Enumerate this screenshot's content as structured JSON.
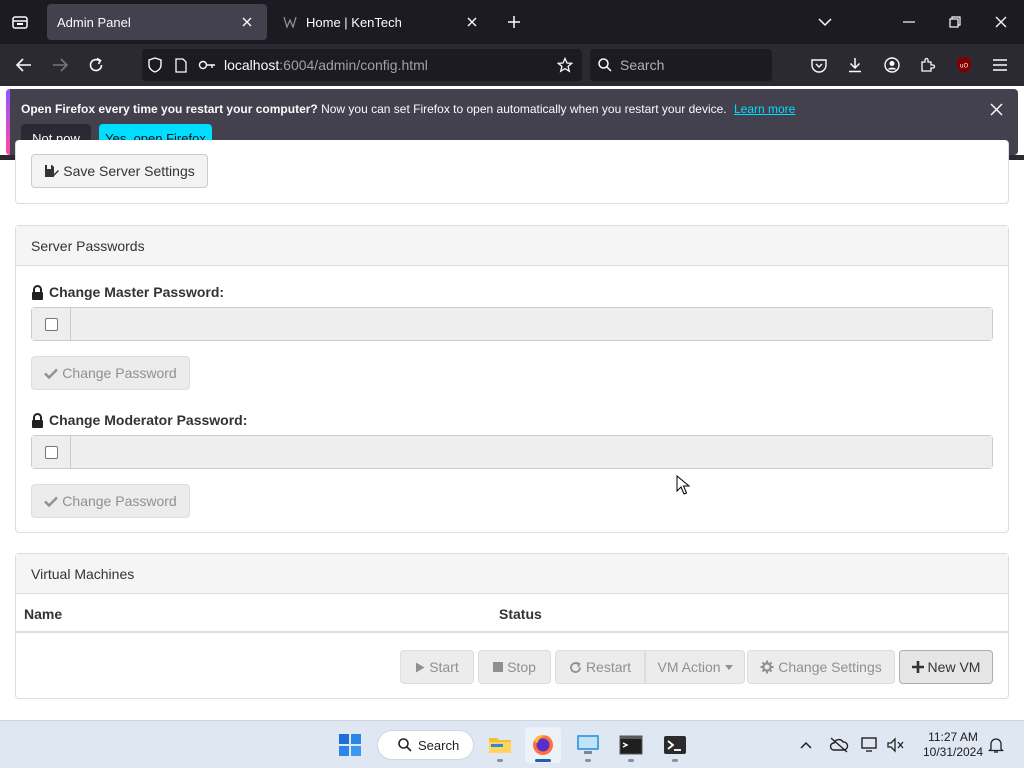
{
  "browser": {
    "tabs": [
      {
        "title": "Admin Panel",
        "active": true
      },
      {
        "title": "Home | KenTech",
        "active": false
      }
    ],
    "url_host": "localhost",
    "url_rest": ":6004/admin/config.html",
    "search_placeholder": "Search"
  },
  "notification": {
    "bold_text": "Open Firefox every time you restart your computer?",
    "text": "Now you can set Firefox to open automatically when you restart your device.",
    "learn_more": "Learn more",
    "not_now": "Not now",
    "yes_open": "Yes, open Firefox"
  },
  "server_settings": {
    "save_button": "Save Server Settings"
  },
  "server_passwords": {
    "heading": "Server Passwords",
    "master_label": "Change Master Password:",
    "moderator_label": "Change Moderator Password:",
    "change_button": "Change Password"
  },
  "virtual_machines": {
    "heading": "Virtual Machines",
    "columns": [
      "Name",
      "Status"
    ],
    "buttons": {
      "start": "Start",
      "stop": "Stop",
      "restart": "Restart",
      "vm_action": "VM Action",
      "change_settings": "Change Settings",
      "new_vm": "New VM"
    }
  },
  "taskbar": {
    "search": "Search",
    "time": "11:27 AM",
    "date": "10/31/2024"
  },
  "colors": {
    "accent_cyan": "#00ddff",
    "browser_dark": "#1c1b22",
    "panel_heading": "#f5f5f5"
  }
}
